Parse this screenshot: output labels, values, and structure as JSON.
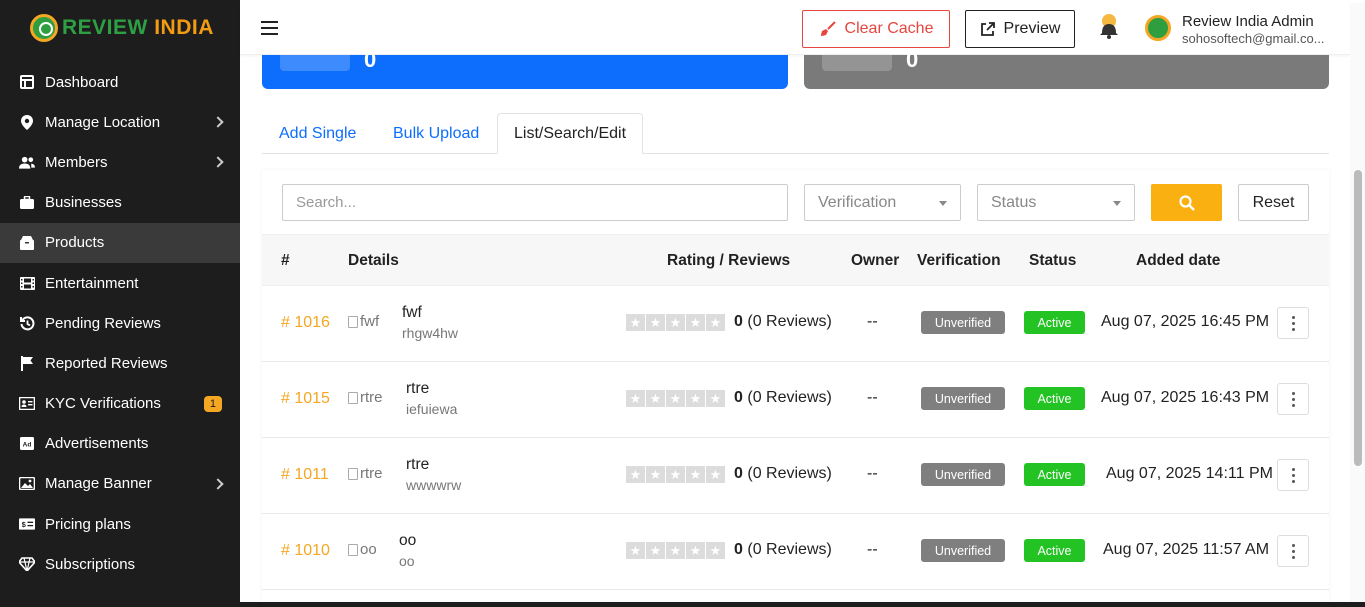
{
  "brand": {
    "part1": "REVIEW",
    "part2": "INDIA"
  },
  "sidebar": {
    "items": [
      {
        "label": "Dashboard",
        "icon": "dashboard-icon",
        "chevron": false,
        "active": false
      },
      {
        "label": "Manage Location",
        "icon": "location-pin-icon",
        "chevron": true,
        "active": false
      },
      {
        "label": "Members",
        "icon": "users-icon",
        "chevron": true,
        "active": false
      },
      {
        "label": "Businesses",
        "icon": "briefcase-icon",
        "chevron": false,
        "active": false
      },
      {
        "label": "Products",
        "icon": "box-icon",
        "chevron": false,
        "active": true
      },
      {
        "label": "Entertainment",
        "icon": "film-icon",
        "chevron": false,
        "active": false
      },
      {
        "label": "Pending Reviews",
        "icon": "history-icon",
        "chevron": false,
        "active": false
      },
      {
        "label": "Reported Reviews",
        "icon": "flag-icon",
        "chevron": false,
        "active": false
      },
      {
        "label": "KYC Verifications",
        "icon": "id-card-icon",
        "chevron": false,
        "active": false,
        "badge": "1"
      },
      {
        "label": "Advertisements",
        "icon": "ad-icon",
        "chevron": false,
        "active": false
      },
      {
        "label": "Manage Banner",
        "icon": "image-icon",
        "chevron": true,
        "active": false
      },
      {
        "label": "Pricing plans",
        "icon": "money-icon",
        "chevron": false,
        "active": false
      },
      {
        "label": "Subscriptions",
        "icon": "gem-icon",
        "chevron": false,
        "active": false
      }
    ]
  },
  "header": {
    "clear_cache_label": "Clear Cache",
    "preview_label": "Preview",
    "admin_name": "Review India Admin",
    "admin_email": "sohosoftech@gmail.co..."
  },
  "cards": {
    "blue_value": "0",
    "gray_value": "0"
  },
  "tabs": [
    {
      "label": "Add Single",
      "active": false
    },
    {
      "label": "Bulk Upload",
      "active": false
    },
    {
      "label": "List/Search/Edit",
      "active": true
    }
  ],
  "filters": {
    "search_placeholder": "Search...",
    "verification_placeholder": "Verification",
    "status_placeholder": "Status",
    "reset_label": "Reset"
  },
  "table": {
    "headers": {
      "num": "#",
      "details": "Details",
      "rating": "Rating / Reviews",
      "owner": "Owner",
      "verification": "Verification",
      "status": "Status",
      "added": "Added date"
    },
    "rows": [
      {
        "id": "# 1016",
        "alt": "fwf",
        "name": "fwf",
        "sub": "rhgw4hw",
        "rating": "0",
        "reviews": "(0 Reviews)",
        "owner": "--",
        "verification": "Unverified",
        "status": "Active",
        "date": "Aug 07, 2025 16:45 PM"
      },
      {
        "id": "# 1015",
        "alt": "rtre",
        "name": "rtre",
        "sub": "iefuiewa",
        "rating": "0",
        "reviews": "(0 Reviews)",
        "owner": "--",
        "verification": "Unverified",
        "status": "Active",
        "date": "Aug 07, 2025 16:43 PM"
      },
      {
        "id": "# 1011",
        "alt": "rtre",
        "name": "rtre",
        "sub": "wwwwrw",
        "rating": "0",
        "reviews": "(0 Reviews)",
        "owner": "--",
        "verification": "Unverified",
        "status": "Active",
        "date": "Aug 07, 2025 14:11 PM"
      },
      {
        "id": "# 1010",
        "alt": "oo",
        "name": "oo",
        "sub": "oo",
        "rating": "0",
        "reviews": "(0 Reviews)",
        "owner": "--",
        "verification": "Unverified",
        "status": "Active",
        "date": "Aug 07, 2025 11:57 AM"
      }
    ]
  },
  "colors": {
    "sidebar_bg": "#1d1d1d",
    "accent_orange": "#fbb012",
    "primary_blue": "#0d6efd",
    "danger_red": "#e5473f",
    "active_green": "#22c322",
    "unverified_gray": "#7f7f7f"
  }
}
